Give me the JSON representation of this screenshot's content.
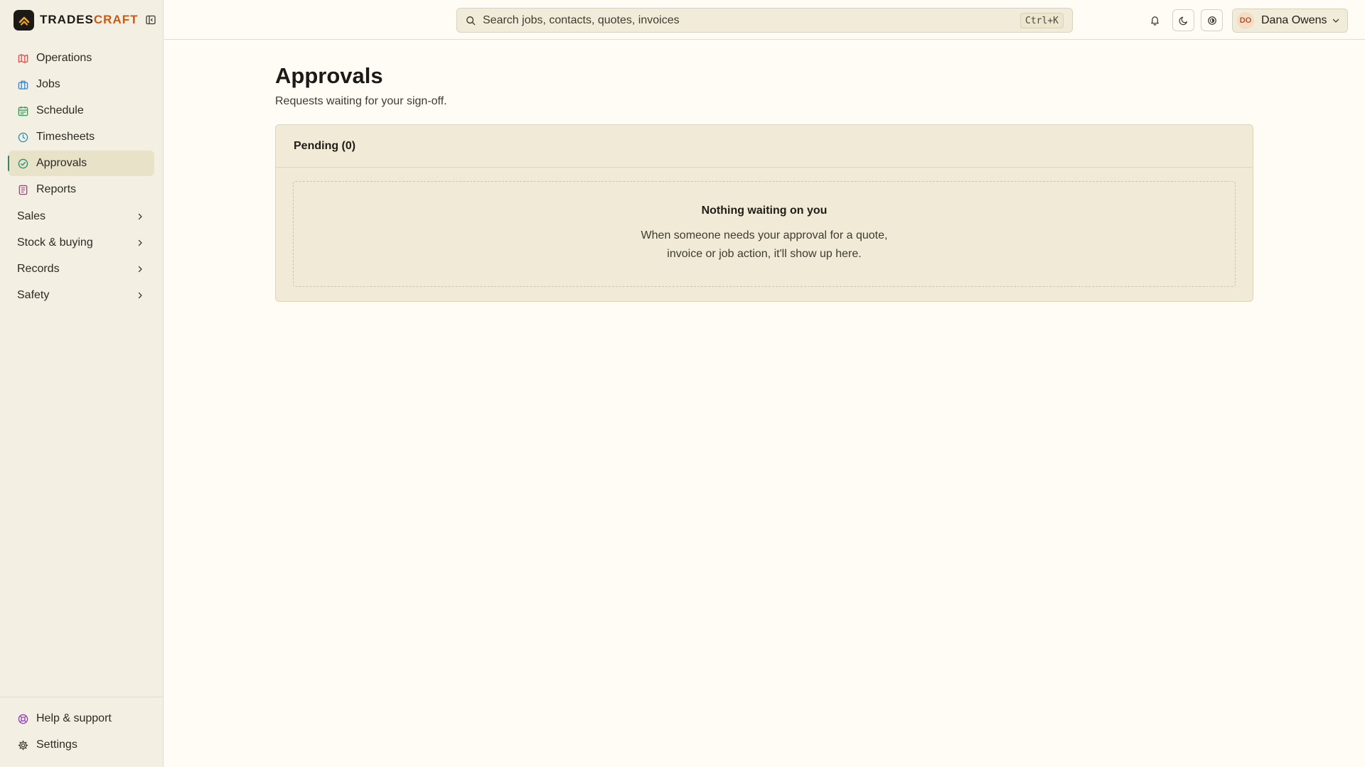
{
  "brand": {
    "name_main": "TRADES",
    "name_accent": "CRAFT",
    "accent_color": "#c65a17"
  },
  "sidebar": {
    "items": [
      {
        "label": "Operations",
        "icon": "map-icon",
        "color": "#d9534f"
      },
      {
        "label": "Jobs",
        "icon": "briefcase-icon",
        "color": "#3b82c4"
      },
      {
        "label": "Schedule",
        "icon": "calendar-icon",
        "color": "#2f9a55"
      },
      {
        "label": "Timesheets",
        "icon": "clock-icon",
        "color": "#2f8fb0"
      },
      {
        "label": "Approvals",
        "icon": "check-circle-icon",
        "color": "#2f8a6a",
        "active": true
      },
      {
        "label": "Reports",
        "icon": "document-icon",
        "color": "#b03a8a"
      }
    ],
    "groups": [
      {
        "label": "Sales"
      },
      {
        "label": "Stock & buying"
      },
      {
        "label": "Records"
      },
      {
        "label": "Safety"
      }
    ],
    "bottom": [
      {
        "label": "Help & support",
        "icon": "lifebuoy-icon",
        "color": "#8a3fb0"
      },
      {
        "label": "Settings",
        "icon": "gear-icon",
        "color": "#3e3b33"
      }
    ]
  },
  "topbar": {
    "search_placeholder": "Search jobs, contacts, quotes, invoices",
    "search_shortcut": "Ctrl+K",
    "user": {
      "initials": "DO",
      "name": "Dana Owens"
    }
  },
  "page": {
    "title": "Approvals",
    "subtitle": "Requests waiting for your sign-off.",
    "card_header": "Pending (0)",
    "empty_title": "Nothing waiting on you",
    "empty_text": "When someone needs your approval for a quote, invoice or job action, it'll show up here."
  }
}
